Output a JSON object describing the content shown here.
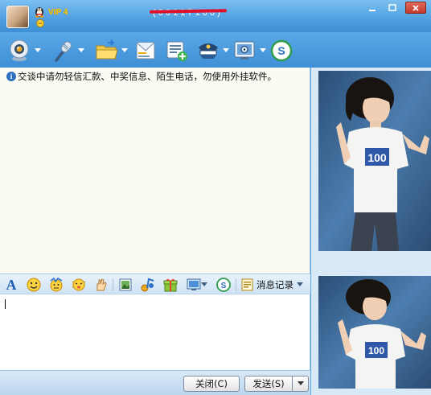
{
  "titlebar": {
    "vip_label": "VIP 4",
    "contact_number": "( 0 0 1 1 7 1 0 0 )",
    "controls": [
      "minimize",
      "maximize",
      "close"
    ]
  },
  "toolbar": {
    "buttons": [
      "video-call",
      "voice-call",
      "send-file",
      "send-sms",
      "create-discussion",
      "application",
      "settings",
      "soso"
    ]
  },
  "chat": {
    "notice": "交谈中请勿轻信汇款、中奖信息、陌生电话，勿使用外挂软件。"
  },
  "input_toolbar": {
    "items": [
      "font",
      "emoticon",
      "magic-emoticon",
      "shake",
      "hand-write",
      "screenshot",
      "music",
      "gift",
      "image",
      "soso"
    ],
    "history_label": "消息记录"
  },
  "bottom": {
    "close_label": "关闭(C)",
    "send_label": "发送(S)"
  },
  "colors": {
    "title_blue": "#4f9fe0",
    "chat_bg": "#fbfbf3",
    "redact_red": "#e0102a"
  }
}
